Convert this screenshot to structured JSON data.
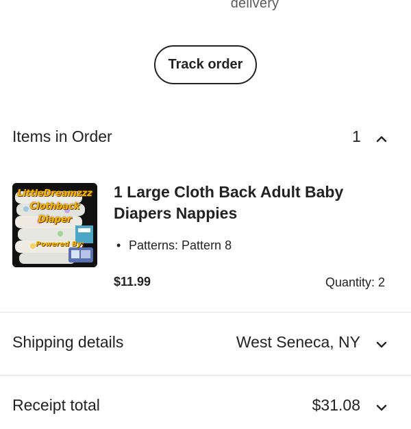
{
  "delivery_text": "delivery",
  "track_order_label": "Track order",
  "items_section": {
    "title": "Items in Order",
    "count": "1",
    "expanded_icon": "chevron-up-icon"
  },
  "item": {
    "thumbnail_lines": [
      "LittleDreamzzz",
      "Clothback",
      "Diaper"
    ],
    "thumbnail_footer": "Powered By:",
    "title": "1 Large Cloth Back Adult Baby Diapers Nappies",
    "variation": "Patterns: Pattern 8",
    "price": "$11.99",
    "quantity": "Quantity: 2"
  },
  "shipping": {
    "label": "Shipping details",
    "value": "West Seneca, NY",
    "icon": "chevron-down-icon"
  },
  "receipt": {
    "label": "Receipt total",
    "value": "$31.08",
    "icon": "chevron-down-icon"
  },
  "colors": {
    "text": "#222222",
    "secondary_text": "#595959",
    "divider": "#e1e1e1",
    "thumbnail_accent": "#f5b800"
  }
}
